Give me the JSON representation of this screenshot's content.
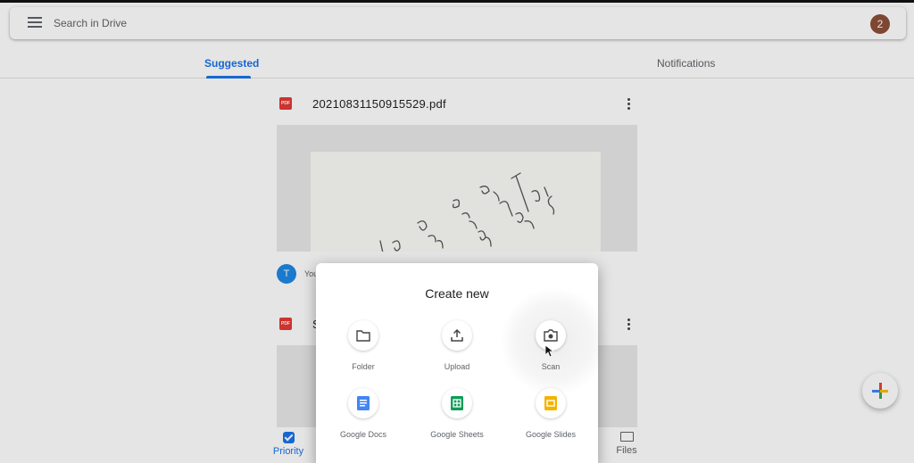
{
  "search": {
    "placeholder": "Search in Drive",
    "account_badge": "2"
  },
  "tabs": [
    {
      "label": "Suggested",
      "selected": true
    },
    {
      "label": "Notifications",
      "selected": false
    }
  ],
  "files": [
    {
      "name": "20210831150915529.pdf",
      "type_badge": "PDF"
    },
    {
      "name": "S",
      "type_badge": "PDF"
    }
  ],
  "owner": {
    "initial": "T",
    "text": "You"
  },
  "bottom_nav": {
    "priority": "Priority",
    "files": "Files"
  },
  "dialog": {
    "title": "Create new",
    "items": [
      {
        "label": "Folder",
        "icon": "folder-icon"
      },
      {
        "label": "Upload",
        "icon": "upload-icon"
      },
      {
        "label": "Scan",
        "icon": "camera-icon"
      },
      {
        "label": "Google Docs",
        "icon": "docs-icon"
      },
      {
        "label": "Google Sheets",
        "icon": "sheets-icon"
      },
      {
        "label": "Google Slides",
        "icon": "slides-icon"
      }
    ]
  },
  "colors": {
    "accent": "#1a73e8",
    "pdf": "#e53935",
    "docs": "#4285f4",
    "sheets": "#0f9d58",
    "slides": "#f4b400"
  }
}
